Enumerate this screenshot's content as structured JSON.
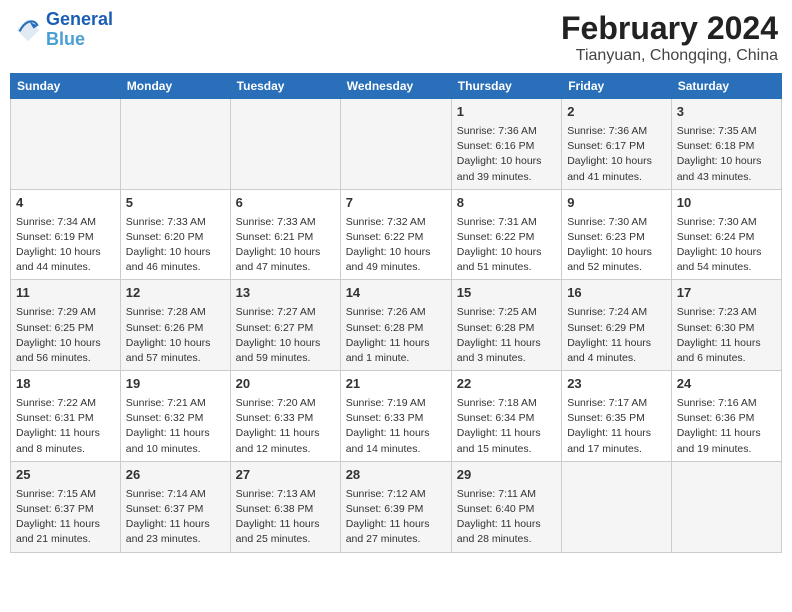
{
  "header": {
    "logo_line1": "General",
    "logo_line2": "Blue",
    "month": "February 2024",
    "location": "Tianyuan, Chongqing, China"
  },
  "days_of_week": [
    "Sunday",
    "Monday",
    "Tuesday",
    "Wednesday",
    "Thursday",
    "Friday",
    "Saturday"
  ],
  "weeks": [
    [
      {
        "day": "",
        "content": ""
      },
      {
        "day": "",
        "content": ""
      },
      {
        "day": "",
        "content": ""
      },
      {
        "day": "",
        "content": ""
      },
      {
        "day": "1",
        "content": "Sunrise: 7:36 AM\nSunset: 6:16 PM\nDaylight: 10 hours and 39 minutes."
      },
      {
        "day": "2",
        "content": "Sunrise: 7:36 AM\nSunset: 6:17 PM\nDaylight: 10 hours and 41 minutes."
      },
      {
        "day": "3",
        "content": "Sunrise: 7:35 AM\nSunset: 6:18 PM\nDaylight: 10 hours and 43 minutes."
      }
    ],
    [
      {
        "day": "4",
        "content": "Sunrise: 7:34 AM\nSunset: 6:19 PM\nDaylight: 10 hours and 44 minutes."
      },
      {
        "day": "5",
        "content": "Sunrise: 7:33 AM\nSunset: 6:20 PM\nDaylight: 10 hours and 46 minutes."
      },
      {
        "day": "6",
        "content": "Sunrise: 7:33 AM\nSunset: 6:21 PM\nDaylight: 10 hours and 47 minutes."
      },
      {
        "day": "7",
        "content": "Sunrise: 7:32 AM\nSunset: 6:22 PM\nDaylight: 10 hours and 49 minutes."
      },
      {
        "day": "8",
        "content": "Sunrise: 7:31 AM\nSunset: 6:22 PM\nDaylight: 10 hours and 51 minutes."
      },
      {
        "day": "9",
        "content": "Sunrise: 7:30 AM\nSunset: 6:23 PM\nDaylight: 10 hours and 52 minutes."
      },
      {
        "day": "10",
        "content": "Sunrise: 7:30 AM\nSunset: 6:24 PM\nDaylight: 10 hours and 54 minutes."
      }
    ],
    [
      {
        "day": "11",
        "content": "Sunrise: 7:29 AM\nSunset: 6:25 PM\nDaylight: 10 hours and 56 minutes."
      },
      {
        "day": "12",
        "content": "Sunrise: 7:28 AM\nSunset: 6:26 PM\nDaylight: 10 hours and 57 minutes."
      },
      {
        "day": "13",
        "content": "Sunrise: 7:27 AM\nSunset: 6:27 PM\nDaylight: 10 hours and 59 minutes."
      },
      {
        "day": "14",
        "content": "Sunrise: 7:26 AM\nSunset: 6:28 PM\nDaylight: 11 hours and 1 minute."
      },
      {
        "day": "15",
        "content": "Sunrise: 7:25 AM\nSunset: 6:28 PM\nDaylight: 11 hours and 3 minutes."
      },
      {
        "day": "16",
        "content": "Sunrise: 7:24 AM\nSunset: 6:29 PM\nDaylight: 11 hours and 4 minutes."
      },
      {
        "day": "17",
        "content": "Sunrise: 7:23 AM\nSunset: 6:30 PM\nDaylight: 11 hours and 6 minutes."
      }
    ],
    [
      {
        "day": "18",
        "content": "Sunrise: 7:22 AM\nSunset: 6:31 PM\nDaylight: 11 hours and 8 minutes."
      },
      {
        "day": "19",
        "content": "Sunrise: 7:21 AM\nSunset: 6:32 PM\nDaylight: 11 hours and 10 minutes."
      },
      {
        "day": "20",
        "content": "Sunrise: 7:20 AM\nSunset: 6:33 PM\nDaylight: 11 hours and 12 minutes."
      },
      {
        "day": "21",
        "content": "Sunrise: 7:19 AM\nSunset: 6:33 PM\nDaylight: 11 hours and 14 minutes."
      },
      {
        "day": "22",
        "content": "Sunrise: 7:18 AM\nSunset: 6:34 PM\nDaylight: 11 hours and 15 minutes."
      },
      {
        "day": "23",
        "content": "Sunrise: 7:17 AM\nSunset: 6:35 PM\nDaylight: 11 hours and 17 minutes."
      },
      {
        "day": "24",
        "content": "Sunrise: 7:16 AM\nSunset: 6:36 PM\nDaylight: 11 hours and 19 minutes."
      }
    ],
    [
      {
        "day": "25",
        "content": "Sunrise: 7:15 AM\nSunset: 6:37 PM\nDaylight: 11 hours and 21 minutes."
      },
      {
        "day": "26",
        "content": "Sunrise: 7:14 AM\nSunset: 6:37 PM\nDaylight: 11 hours and 23 minutes."
      },
      {
        "day": "27",
        "content": "Sunrise: 7:13 AM\nSunset: 6:38 PM\nDaylight: 11 hours and 25 minutes."
      },
      {
        "day": "28",
        "content": "Sunrise: 7:12 AM\nSunset: 6:39 PM\nDaylight: 11 hours and 27 minutes."
      },
      {
        "day": "29",
        "content": "Sunrise: 7:11 AM\nSunset: 6:40 PM\nDaylight: 11 hours and 28 minutes."
      },
      {
        "day": "",
        "content": ""
      },
      {
        "day": "",
        "content": ""
      }
    ]
  ]
}
